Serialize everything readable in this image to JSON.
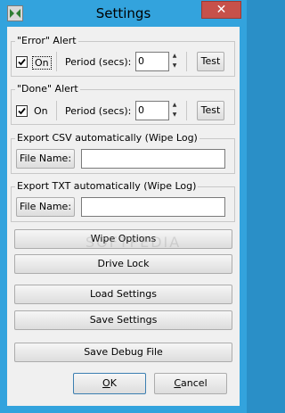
{
  "window": {
    "title": "Settings",
    "close_glyph": "✕"
  },
  "error_alert": {
    "legend": "\"Error\" Alert",
    "on_label": "On",
    "checked": true,
    "period_label": "Period (secs):",
    "period_value": "0",
    "test_label": "Test"
  },
  "done_alert": {
    "legend": "\"Done\" Alert",
    "on_label": "On",
    "checked": true,
    "period_label": "Period (secs):",
    "period_value": "0",
    "test_label": "Test"
  },
  "export_csv": {
    "legend": "Export CSV automatically (Wipe Log)",
    "file_button": "File Name:",
    "file_value": ""
  },
  "export_txt": {
    "legend": "Export TXT automatically (Wipe Log)",
    "file_button": "File Name:",
    "file_value": ""
  },
  "buttons": {
    "wipe_options": "Wipe Options",
    "drive_lock": "Drive Lock",
    "load_settings": "Load Settings",
    "save_settings": "Save Settings",
    "save_debug": "Save Debug File",
    "ok": "OK",
    "cancel": "Cancel"
  },
  "watermark": "SOFTPEDIA",
  "icons": {
    "app": "app-logo-icon",
    "close": "close-icon",
    "check": "checkmark-icon",
    "spin_up": "triangle-up-icon",
    "spin_down": "triangle-down-icon"
  }
}
